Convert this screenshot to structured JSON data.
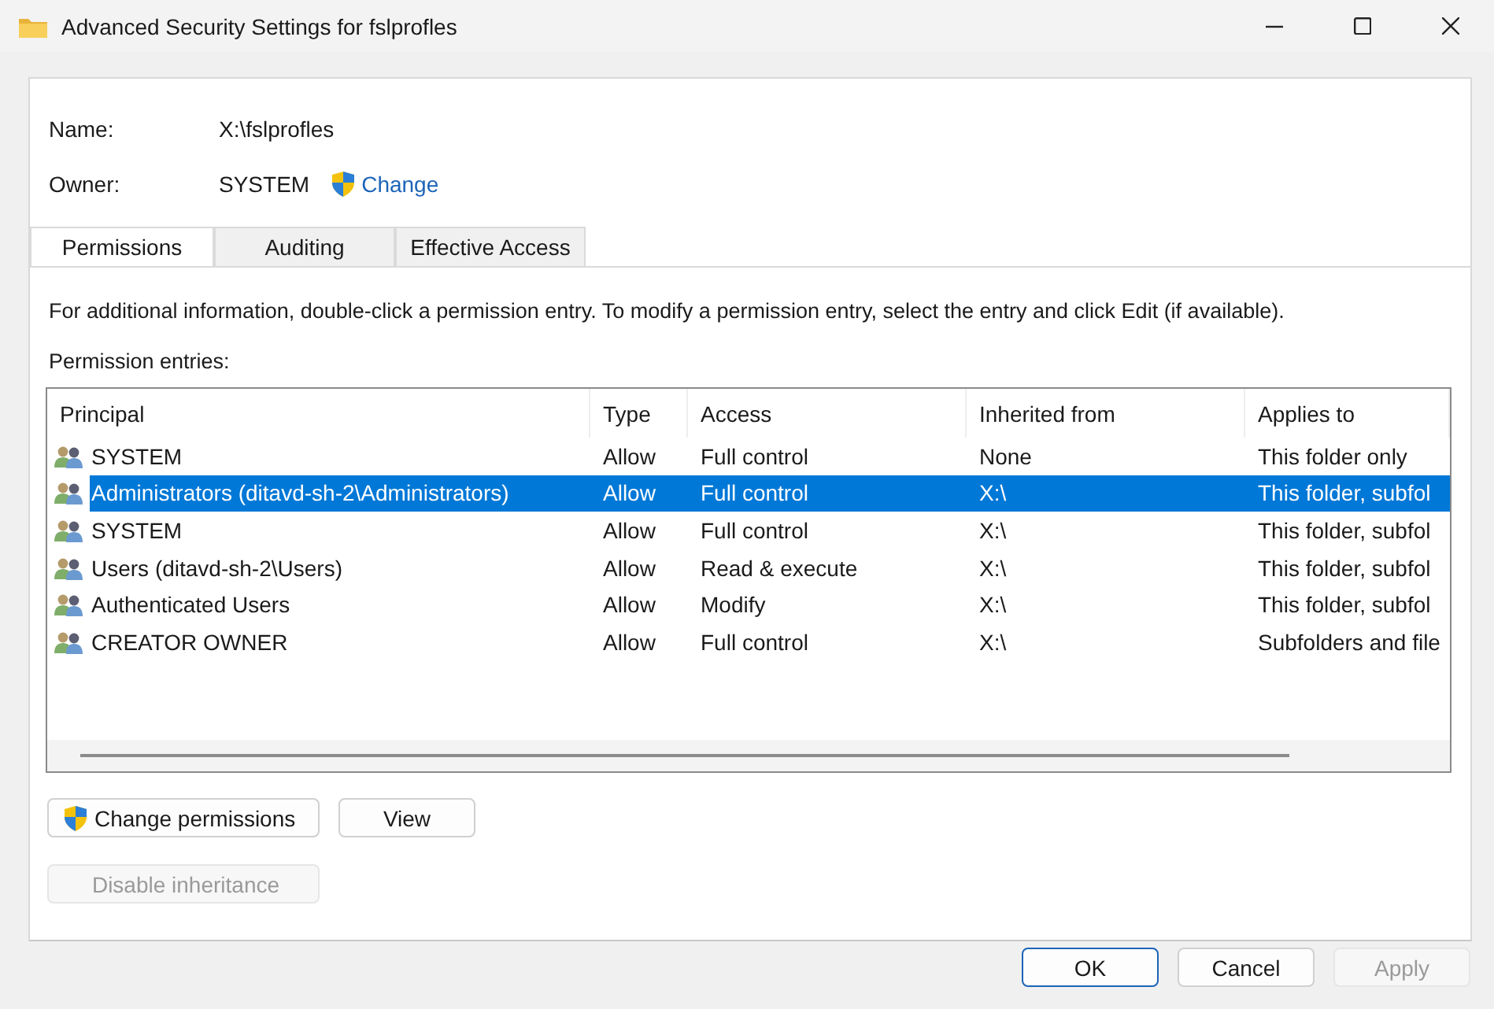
{
  "window": {
    "title": "Advanced Security Settings for fslprofles"
  },
  "name_field": {
    "label": "Name:",
    "value": "X:\\fslprofles"
  },
  "owner": {
    "label": "Owner:",
    "value": "SYSTEM",
    "link": "Change"
  },
  "tabs": [
    {
      "label": "Permissions",
      "selected": true
    },
    {
      "label": "Auditing",
      "selected": false
    },
    {
      "label": "Effective Access",
      "selected": false
    }
  ],
  "info_text": "For additional information, double-click a permission entry. To modify a permission entry, select the entry and click Edit (if available).",
  "entries_label": "Permission entries:",
  "table": {
    "columns": [
      "Principal",
      "Type",
      "Access",
      "Inherited from",
      "Applies to"
    ],
    "rows": [
      {
        "principal": "SYSTEM",
        "type": "Allow",
        "access": "Full control",
        "inherited_from": "None",
        "applies_to": "This folder only",
        "selected": false
      },
      {
        "principal": "Administrators (ditavd-sh-2\\Administrators)",
        "type": "Allow",
        "access": "Full control",
        "inherited_from": "X:\\",
        "applies_to": "This folder, subfol",
        "selected": true
      },
      {
        "principal": "SYSTEM",
        "type": "Allow",
        "access": "Full control",
        "inherited_from": "X:\\",
        "applies_to": "This folder, subfol",
        "selected": false
      },
      {
        "principal": "Users (ditavd-sh-2\\Users)",
        "type": "Allow",
        "access": "Read & execute",
        "inherited_from": "X:\\",
        "applies_to": "This folder, subfol",
        "selected": false
      },
      {
        "principal": "Authenticated Users",
        "type": "Allow",
        "access": "Modify",
        "inherited_from": "X:\\",
        "applies_to": "This folder, subfol",
        "selected": false
      },
      {
        "principal": "CREATOR OWNER",
        "type": "Allow",
        "access": "Full control",
        "inherited_from": "X:\\",
        "applies_to": "Subfolders and file",
        "selected": false
      }
    ]
  },
  "action_buttons": [
    {
      "label": "Change permissions",
      "shield": true,
      "disabled": false
    },
    {
      "label": "View",
      "shield": false,
      "disabled": false
    }
  ],
  "inheritance_button": {
    "label": "Disable inheritance",
    "disabled": true
  },
  "dialog_buttons": [
    {
      "label": "OK",
      "default": true,
      "disabled": false
    },
    {
      "label": "Cancel",
      "default": false,
      "disabled": false
    },
    {
      "label": "Apply",
      "default": false,
      "disabled": true
    }
  ]
}
